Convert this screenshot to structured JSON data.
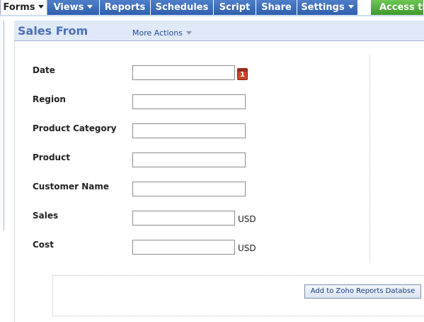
{
  "tabs": [
    {
      "label": "Forms",
      "dropdown": true,
      "active": true
    },
    {
      "label": "Views",
      "dropdown": true
    },
    {
      "label": "Reports",
      "dropdown": false
    },
    {
      "label": "Schedules",
      "dropdown": false
    },
    {
      "label": "Script",
      "dropdown": false
    },
    {
      "label": "Share",
      "dropdown": false
    },
    {
      "label": "Settings",
      "dropdown": true
    },
    {
      "label": "Access thi",
      "dropdown": false
    }
  ],
  "header": {
    "title": "Sales From",
    "more_actions": "More Actions"
  },
  "form": {
    "fields": [
      {
        "label": "Date",
        "value": "",
        "unit": ""
      },
      {
        "label": "Region",
        "value": "",
        "unit": ""
      },
      {
        "label": "Product Category",
        "value": "",
        "unit": ""
      },
      {
        "label": "Product",
        "value": "",
        "unit": ""
      },
      {
        "label": "Customer Name",
        "value": "",
        "unit": ""
      },
      {
        "label": "Sales",
        "value": "",
        "unit": "USD"
      },
      {
        "label": "Cost",
        "value": "",
        "unit": "USD"
      }
    ],
    "calendar_icon": "calendar-icon",
    "calendar_day": "1",
    "submit_label": "Add to Zoho Reports Databse"
  },
  "colors": {
    "tab_blue": "#3a6abb",
    "tab_green": "#4fad39",
    "header_bg": "#dfe9f8",
    "title_color": "#4a6fb7",
    "calendar_red": "#c8452b"
  }
}
